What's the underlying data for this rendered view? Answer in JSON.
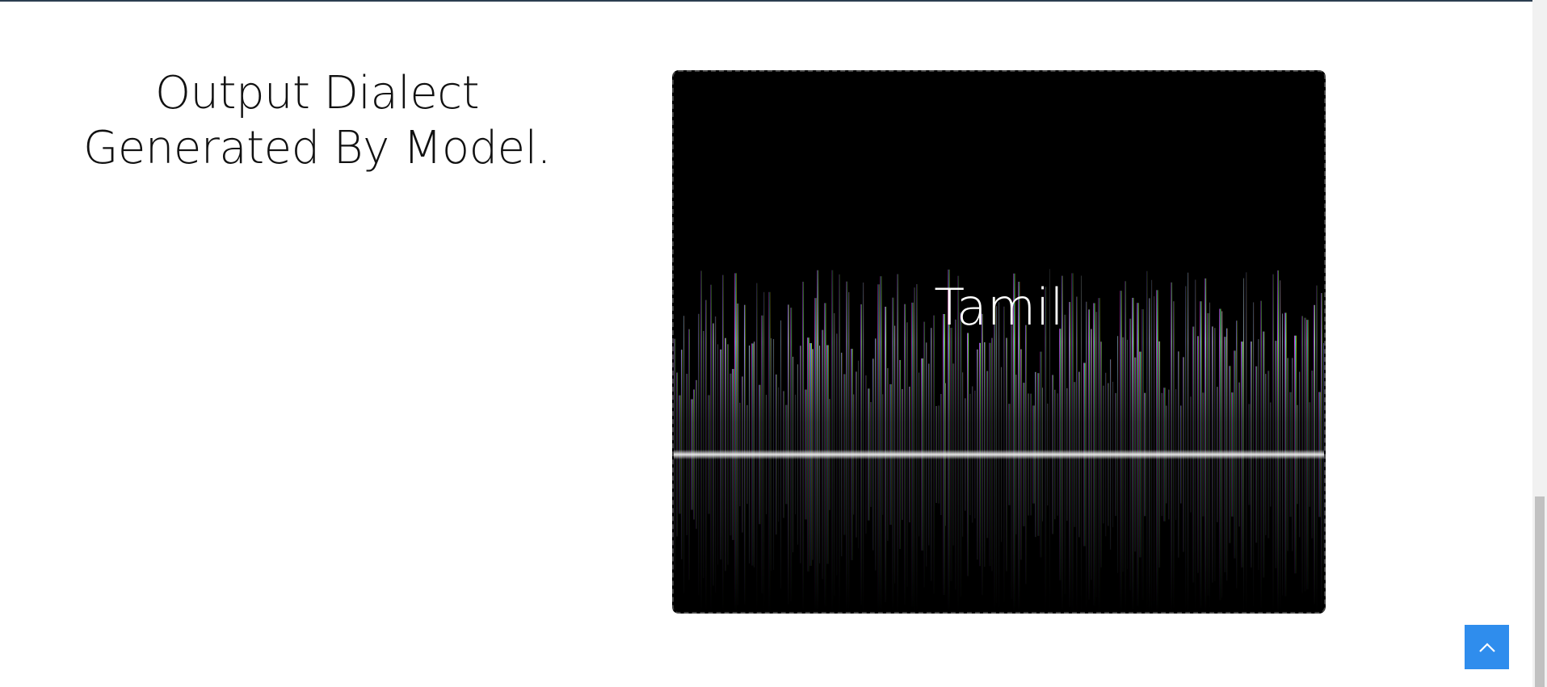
{
  "section": {
    "heading_line1": "Output Dialect",
    "heading_line2": "Generated By Model."
  },
  "result": {
    "dialect": "Tamil"
  },
  "icons": {
    "wave": "sound-wave-icon",
    "back_to_top": "chevron-up-icon"
  },
  "colors": {
    "wave_gradient_start": "#ff3d8f",
    "wave_gradient_end": "#ff6b5b",
    "back_to_top_bg": "#2f8ded",
    "panel_bg": "#000000"
  }
}
